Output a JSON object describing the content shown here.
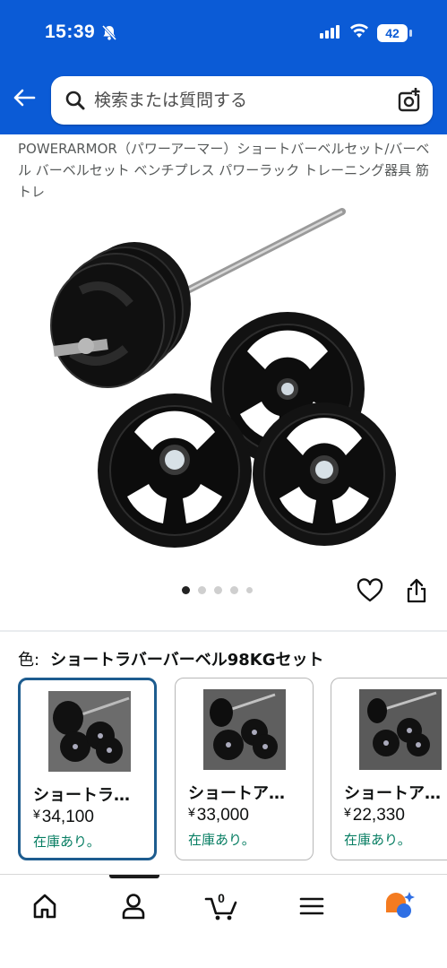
{
  "status": {
    "time": "15:39",
    "battery": "42"
  },
  "search": {
    "placeholder": "検索または質問する"
  },
  "product": {
    "title": "POWERARMOR（パワーアーマー）ショートバーベルセット/バーベル バーベルセット ベンチプレス パワーラック トレーニング器具 筋トレ"
  },
  "carousel": {
    "image_count": 5,
    "active_index": 0
  },
  "color": {
    "label": "色:",
    "value": "ショートラバーバーベル98KGセット"
  },
  "variants": [
    {
      "name": "ショートラ…",
      "price": "34,100",
      "currency": "¥",
      "stock": "在庫あり。",
      "selected": true
    },
    {
      "name": "ショートア…",
      "price": "33,000",
      "currency": "¥",
      "stock": "在庫あり。",
      "selected": false
    },
    {
      "name": "ショートア…",
      "price": "22,330",
      "currency": "¥",
      "stock": "在庫あり。",
      "selected": false
    }
  ],
  "cart": {
    "count": "0"
  },
  "colors": {
    "header": "#0b5bd6",
    "stock": "#067d62",
    "selected_border": "#1d5c8f",
    "assistant_orange": "#f47b20",
    "assistant_blue": "#2f6fe4"
  },
  "icons": [
    "bell-slash-icon",
    "signal-icon",
    "wifi-icon",
    "back-arrow-icon",
    "search-icon",
    "camera-search-icon",
    "heart-icon",
    "share-icon",
    "home-icon",
    "user-icon",
    "cart-icon",
    "menu-icon",
    "ai-assistant-icon"
  ]
}
